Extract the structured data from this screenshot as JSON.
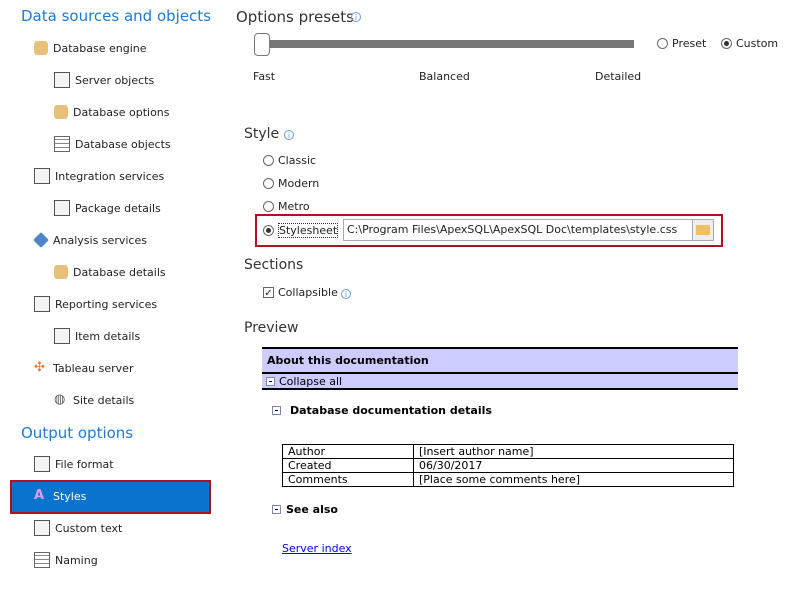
{
  "sidebar": {
    "section1": "Data sources and objects",
    "items": [
      {
        "label": "Database engine",
        "icon": "database-icon"
      },
      {
        "label": "Server objects",
        "icon": "server-objects-icon"
      },
      {
        "label": "Database options",
        "icon": "database-options-icon"
      },
      {
        "label": "Database objects",
        "icon": "table-icon"
      },
      {
        "label": "Integration services",
        "icon": "integration-icon"
      },
      {
        "label": "Package details",
        "icon": "package-icon"
      },
      {
        "label": "Analysis services",
        "icon": "cube-icon"
      },
      {
        "label": "Database details",
        "icon": "database-details-icon"
      },
      {
        "label": "Reporting services",
        "icon": "report-icon"
      },
      {
        "label": "Item details",
        "icon": "item-icon"
      },
      {
        "label": "Tableau server",
        "icon": "tableau-icon"
      },
      {
        "label": "Site details",
        "icon": "globe-icon"
      }
    ],
    "section2": "Output options",
    "output_items": [
      {
        "label": "File format",
        "icon": "file-icon"
      },
      {
        "label": "Styles",
        "icon": "styles-icon"
      },
      {
        "label": "Custom text",
        "icon": "document-icon"
      },
      {
        "label": "Naming",
        "icon": "naming-icon"
      }
    ]
  },
  "presets": {
    "title": "Options presets",
    "labels": [
      "Fast",
      "Balanced",
      "Detailed"
    ],
    "slider_value": 0,
    "preset": "Preset",
    "custom": "Custom",
    "selected": "Custom"
  },
  "style": {
    "title": "Style",
    "options": [
      "Classic",
      "Modern",
      "Metro",
      "Stylesheet"
    ],
    "selected": "Stylesheet",
    "path": "C:\\Program Files\\ApexSQL\\ApexSQL Doc\\templates\\style.css"
  },
  "sections": {
    "title": "Sections",
    "collapsible": "Collapsible",
    "checked": true
  },
  "preview": {
    "title": "Preview",
    "header": "About this documentation",
    "collapse": "Collapse all",
    "details": "Database documentation details",
    "rows": [
      [
        "Author",
        "[Insert author name]"
      ],
      [
        "Created",
        "06/30/2017"
      ],
      [
        "Comments",
        "[Place some comments here]"
      ]
    ],
    "see_also": "See also",
    "link": "Server index"
  },
  "colors": {
    "accent": "#1e7ad6",
    "selected": "#0a73cc",
    "highlight": "#b01020",
    "preview_band": "#ccccff"
  }
}
